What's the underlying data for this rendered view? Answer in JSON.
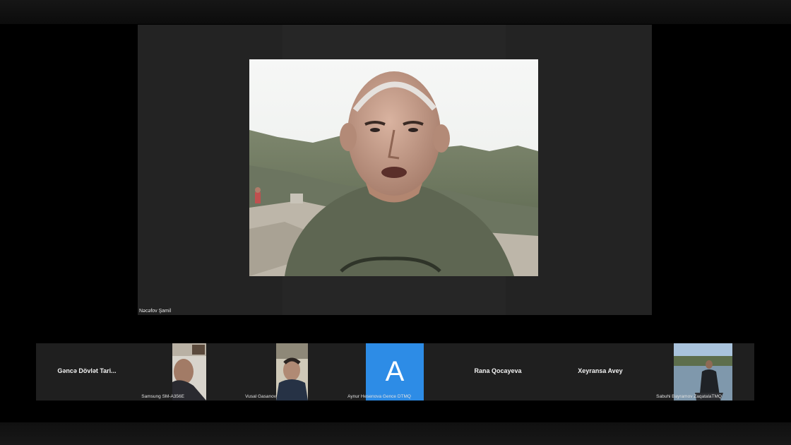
{
  "app": {
    "view": "gallery"
  },
  "main_speaker": {
    "name": "Nəcəfov Şamil"
  },
  "participants": [
    {
      "name": "Gəncə Dövlət Tari...",
      "label": "Samsung SM-A356E",
      "video": true
    },
    {
      "name": "Vusal Gasanov",
      "video": true
    },
    {
      "name": "Aynur Hesenova Gence DTMQ",
      "avatar_letter": "A",
      "avatar_color": "#2D8CE6"
    },
    {
      "name": "Rana Qocayeva",
      "video": false
    },
    {
      "name": "Xeyransa Avey",
      "video": false
    },
    {
      "name": "Sabuhi Bayramov ZaqatalaTMQ",
      "video": true
    }
  ],
  "colors": {
    "background": "#000000",
    "tile": "#1F1F1F",
    "stage": "#232323"
  }
}
